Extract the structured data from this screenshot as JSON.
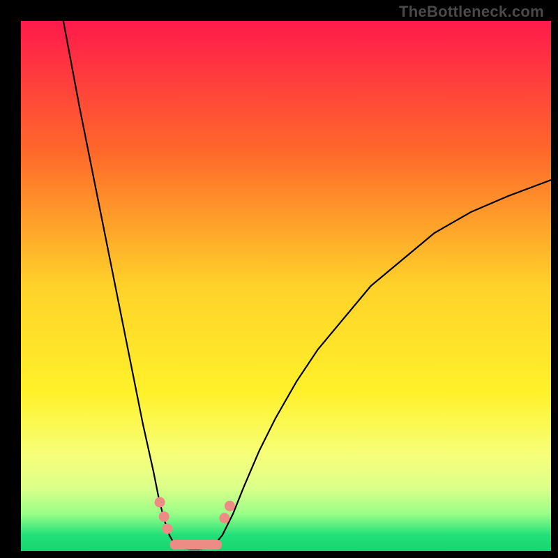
{
  "watermark": "TheBottleneck.com",
  "chart_data": {
    "type": "line",
    "title": "",
    "xlabel": "",
    "ylabel": "",
    "xlim": [
      0,
      100
    ],
    "ylim": [
      0,
      100
    ],
    "gradient_stops": [
      {
        "offset": 0,
        "color": "#ff1a4b"
      },
      {
        "offset": 25,
        "color": "#ff6a2a"
      },
      {
        "offset": 50,
        "color": "#ffd22a"
      },
      {
        "offset": 70,
        "color": "#fff12a"
      },
      {
        "offset": 82,
        "color": "#f6ff7a"
      },
      {
        "offset": 88,
        "color": "#dcff8a"
      },
      {
        "offset": 93,
        "color": "#99ff87"
      },
      {
        "offset": 97,
        "color": "#22e07a"
      },
      {
        "offset": 100,
        "color": "#17d46f"
      }
    ],
    "curve": {
      "description": "bottleneck V-curve; single black line with steep left descent to a flat minimum and a shallower right ascent",
      "points": [
        {
          "x": 8.0,
          "y": 100
        },
        {
          "x": 9.5,
          "y": 92
        },
        {
          "x": 11.0,
          "y": 84
        },
        {
          "x": 13.0,
          "y": 74
        },
        {
          "x": 15.0,
          "y": 64
        },
        {
          "x": 17.0,
          "y": 54
        },
        {
          "x": 19.0,
          "y": 44
        },
        {
          "x": 21.0,
          "y": 34
        },
        {
          "x": 23.0,
          "y": 24
        },
        {
          "x": 25.0,
          "y": 15
        },
        {
          "x": 26.0,
          "y": 10
        },
        {
          "x": 27.0,
          "y": 6
        },
        {
          "x": 28.0,
          "y": 3
        },
        {
          "x": 29.0,
          "y": 1.2
        },
        {
          "x": 30.5,
          "y": 0.5
        },
        {
          "x": 32.0,
          "y": 0.3
        },
        {
          "x": 33.5,
          "y": 0.3
        },
        {
          "x": 35.0,
          "y": 0.5
        },
        {
          "x": 36.5,
          "y": 1.2
        },
        {
          "x": 38.0,
          "y": 3
        },
        {
          "x": 40.0,
          "y": 7
        },
        {
          "x": 42.0,
          "y": 12
        },
        {
          "x": 45.0,
          "y": 19
        },
        {
          "x": 48.0,
          "y": 25
        },
        {
          "x": 52.0,
          "y": 32
        },
        {
          "x": 56.0,
          "y": 38
        },
        {
          "x": 61.0,
          "y": 44
        },
        {
          "x": 66.0,
          "y": 50
        },
        {
          "x": 72.0,
          "y": 55
        },
        {
          "x": 78.0,
          "y": 60
        },
        {
          "x": 85.0,
          "y": 64
        },
        {
          "x": 92.0,
          "y": 67
        },
        {
          "x": 100.0,
          "y": 70
        }
      ]
    },
    "markers": {
      "description": "small salmon/pink circles & rounded segments near curve trough, sitting on green band",
      "color": "#ed8b85",
      "points": [
        {
          "x": 26.2,
          "y": 9.2
        },
        {
          "x": 27.0,
          "y": 6.5
        },
        {
          "x": 27.6,
          "y": 4.2
        },
        {
          "x": 38.4,
          "y": 6.2
        },
        {
          "x": 39.4,
          "y": 8.5
        }
      ],
      "baseline_segment": {
        "x0": 29.0,
        "x1": 37.0,
        "y": 1.2
      }
    }
  }
}
